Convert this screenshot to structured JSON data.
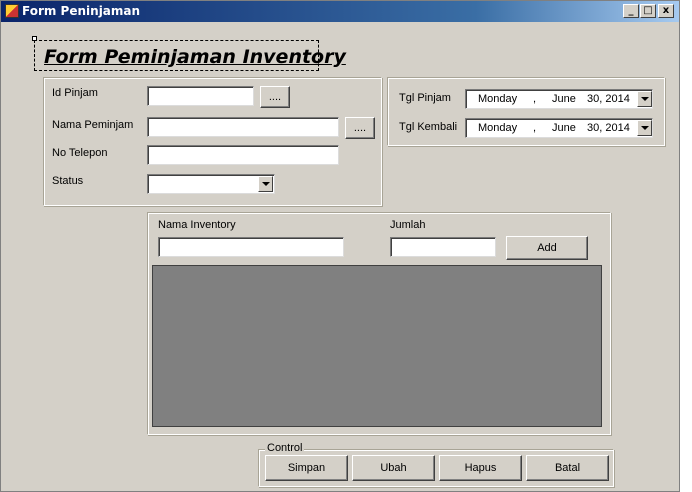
{
  "window": {
    "title": "Form Peninjaman",
    "controls": {
      "minimize": "_",
      "maximize": "□",
      "close": "x"
    }
  },
  "header": {
    "title": "Form Peminjaman Inventory"
  },
  "borrower": {
    "id_label": "Id Pinjam",
    "id_value": "",
    "id_lookup": "....",
    "name_label": "Nama Peminjam",
    "name_value": "",
    "name_lookup": "....",
    "phone_label": "No Telepon",
    "phone_value": "",
    "status_label": "Status",
    "status_value": ""
  },
  "dates": {
    "pinjam_label": "Tgl Pinjam",
    "pinjam": {
      "day": "Monday",
      "sep": ",",
      "month": "June",
      "date": "30, 2014"
    },
    "kembali_label": "Tgl Kembali",
    "kembali": {
      "day": "Monday",
      "sep": ",",
      "month": "June",
      "date": "30, 2014"
    }
  },
  "items": {
    "inventory_label": "Nama Inventory",
    "inventory_value": "",
    "qty_label": "Jumlah",
    "qty_value": "",
    "add_label": "Add"
  },
  "control": {
    "legend": "Control",
    "save": "Simpan",
    "edit": "Ubah",
    "delete": "Hapus",
    "cancel": "Batal"
  }
}
